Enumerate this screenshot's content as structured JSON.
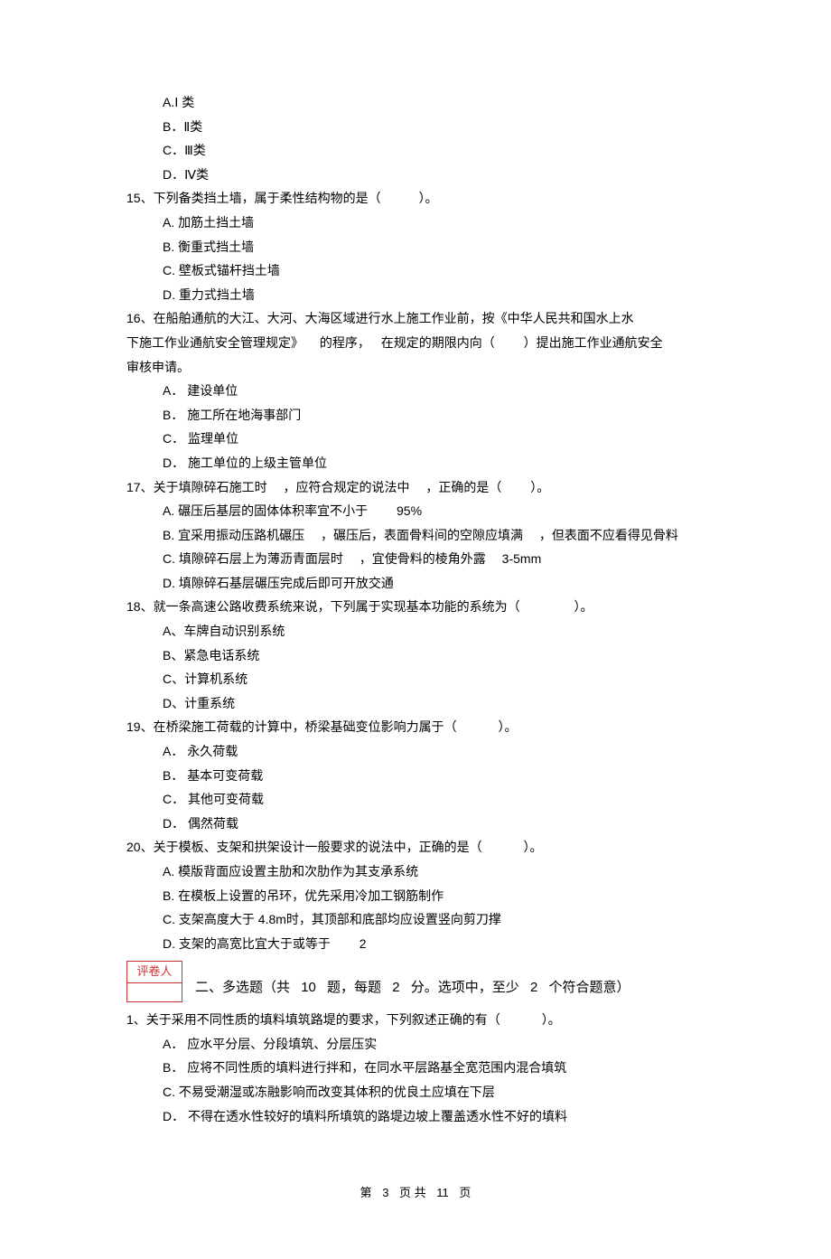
{
  "q14": {
    "A": "A.Ⅰ 类",
    "B": "B．Ⅱ类",
    "C": "C．Ⅲ类",
    "D": "D．Ⅳ类"
  },
  "q15": {
    "stem_a": "15、下列备类挡土墙，属于柔性结构物的是（",
    "stem_b": "）。",
    "A": "A. 加筋土挡土墙",
    "B": "B. 衡重式挡土墙",
    "C": "C. 壁板式锚杆挡土墙",
    "D": "D. 重力式挡土墙"
  },
  "q16": {
    "line1": "16、在船舶通航的大江、大河、大海区域进行水上施工作业前，按《中华人民共和国水上水",
    "line2a": "下施工作业通航安全管理规定》",
    "line2b": "的程序，",
    "line2c": "在规定的期限内向（",
    "line2d": "）提出施工作业通航安全",
    "line3": "审核申请。",
    "A": "A． 建设单位",
    "B": "B． 施工所在地海事部门",
    "C": "C． 监理单位",
    "D": "D． 施工单位的上级主管单位"
  },
  "q17": {
    "stem_a": "17、关于填隙碎石施工时",
    "stem_b": "，应符合规定的说法中",
    "stem_c": "，正确的是（",
    "stem_d": "）。",
    "A_a": "A. 碾压后基层的固体体积率宜不小于",
    "A_b": "95%",
    "B_a": "B. 宜采用振动压路机碾压",
    "B_b": "，碾压后，表面骨料间的空隙应填满",
    "B_c": "，但表面不应看得见骨料",
    "C_a": "C. 填隙碎石层上为薄沥青面层时",
    "C_b": "，宜使骨料的棱角外露",
    "C_c": "3-5mm",
    "D": "D. 填隙碎石基层碾压完成后即可开放交通"
  },
  "q18": {
    "stem_a": "18、就一条高速公路收费系统来说，下列属于实现基本功能的系统为（",
    "stem_b": "）。",
    "A": "A、车牌自动识别系统",
    "B": "B、紧急电话系统",
    "C": "C、计算机系统",
    "D": "D、计重系统"
  },
  "q19": {
    "stem_a": "19、在桥梁施工荷载的计算中，桥梁基础变位影响力属于（",
    "stem_b": "）。",
    "A": "A． 永久荷载",
    "B": "B． 基本可变荷载",
    "C": "C． 其他可变荷载",
    "D": "D． 偶然荷载"
  },
  "q20": {
    "stem_a": "20、关于模板、支架和拱架设计一般要求的说法中，正确的是（",
    "stem_b": "）。",
    "A": "A. 模版背面应设置主肋和次肋作为其支承系统",
    "B": "B. 在模板上设置的吊环，优先采用冷加工钢筋制作",
    "C": "C. 支架高度大于  4.8m时，其顶部和底部均应设置竖向剪刀撑",
    "D_a": "D. 支架的高宽比宜大于或等于",
    "D_b": "2"
  },
  "section2": {
    "grader": "评卷人",
    "title_a": "二、多选题（共",
    "title_b": "10",
    "title_c": "题，每题",
    "title_d": "2",
    "title_e": "分。选项中，至少",
    "title_f": "2",
    "title_g": "个符合题意）"
  },
  "s2q1": {
    "stem_a": "1、关于采用不同性质的填料填筑路堤的要求，下列叙述正确的有（",
    "stem_b": "）。",
    "A": "A． 应水平分层、分段填筑、分层压实",
    "B": "B． 应将不同性质的填料进行拌和，在同水平层路基全宽范围内混合填筑",
    "C": "C. 不易受潮湿或冻融影响而改变其体积的优良土应填在下层",
    "D": "D． 不得在透水性较好的填料所填筑的路堤边坡上覆盖透水性不好的填料"
  },
  "footer": {
    "a": "第",
    "b": "3",
    "c": "页 共",
    "d": "11",
    "e": "页"
  }
}
